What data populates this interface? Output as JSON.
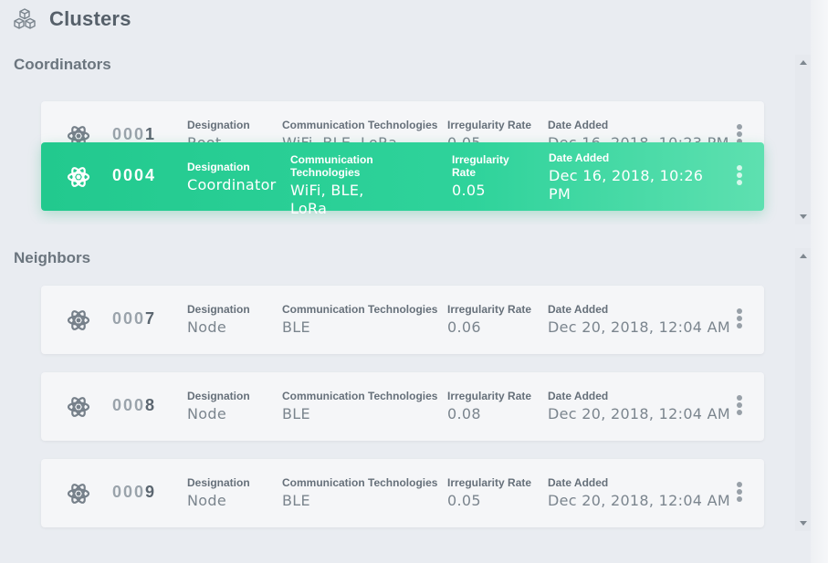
{
  "page": {
    "title": "Clusters",
    "icon": "cubes-icon"
  },
  "labels": {
    "designation": "Designation",
    "communication": "Communication Technologies",
    "irregularity": "Irregularity Rate",
    "date_added": "Date Added"
  },
  "coordinators": {
    "title": "Coordinators",
    "cards": [
      {
        "id_prefix": "000",
        "id_last": "1",
        "designation": "Root",
        "communication": "WiFi, BLE, LoRa",
        "irregularity": "0.05",
        "date_added": "Dec 16, 2018, 10:23 PM"
      },
      {
        "id_prefix": "000",
        "id_last": "4",
        "designation": "Coordinator",
        "communication": "WiFi, BLE, LoRa",
        "irregularity": "0.05",
        "date_added": "Dec 16, 2018, 10:26 PM"
      }
    ]
  },
  "neighbors": {
    "title": "Neighbors",
    "cards": [
      {
        "id_prefix": "000",
        "id_last": "7",
        "designation": "Node",
        "communication": "BLE",
        "irregularity": "0.06",
        "date_added": "Dec 20, 2018, 12:04 AM"
      },
      {
        "id_prefix": "000",
        "id_last": "8",
        "designation": "Node",
        "communication": "BLE",
        "irregularity": "0.08",
        "date_added": "Dec 20, 2018, 12:04 AM"
      },
      {
        "id_prefix": "000",
        "id_last": "9",
        "designation": "Node",
        "communication": "BLE",
        "irregularity": "0.05",
        "date_added": "Dec 20, 2018, 12:04 AM"
      }
    ]
  },
  "colors": {
    "accent": "#2fd39b",
    "background": "#e9ecf1",
    "card": "#f5f6f8"
  }
}
